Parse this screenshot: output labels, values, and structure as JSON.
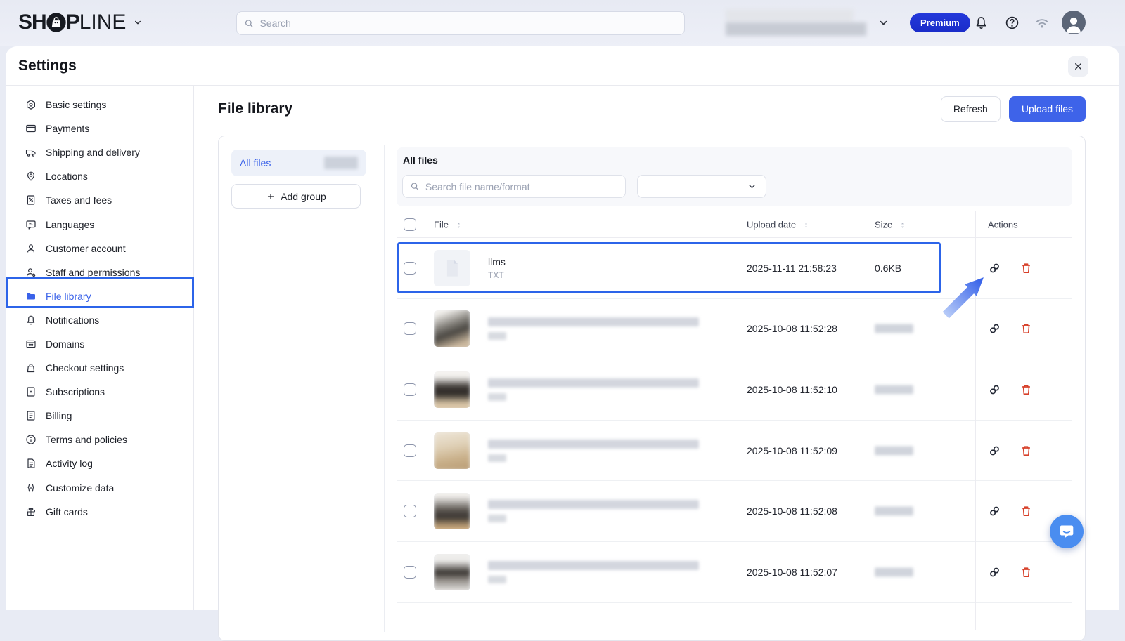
{
  "topbar": {
    "logo_part1": "SH",
    "logo_part2": "P",
    "logo_part3": "LINE",
    "logo_icon": "shopline-bag-icon",
    "search_placeholder": "Search",
    "premium_label": "Premium",
    "icons": [
      "bell-icon",
      "help-icon",
      "wifi-icon",
      "avatar"
    ]
  },
  "settings": {
    "title": "Settings",
    "close_icon": "close-icon"
  },
  "sidebar": {
    "items": [
      {
        "label": "Basic settings",
        "icon": "hexgear"
      },
      {
        "label": "Payments",
        "icon": "card"
      },
      {
        "label": "Shipping and delivery",
        "icon": "truck"
      },
      {
        "label": "Locations",
        "icon": "pin"
      },
      {
        "label": "Taxes and fees",
        "icon": "receipt"
      },
      {
        "label": "Languages",
        "icon": "chat"
      },
      {
        "label": "Customer account",
        "icon": "person"
      },
      {
        "label": "Staff and permissions",
        "icon": "people"
      },
      {
        "label": "File library",
        "icon": "folder",
        "active": true
      },
      {
        "label": "Notifications",
        "icon": "bell"
      },
      {
        "label": "Domains",
        "icon": "browser"
      },
      {
        "label": "Checkout settings",
        "icon": "bag"
      },
      {
        "label": "Subscriptions",
        "icon": "docplus"
      },
      {
        "label": "Billing",
        "icon": "doclines"
      },
      {
        "label": "Terms and policies",
        "icon": "info"
      },
      {
        "label": "Activity log",
        "icon": "doc"
      },
      {
        "label": "Customize data",
        "icon": "braces"
      },
      {
        "label": "Gift cards",
        "icon": "gift"
      }
    ]
  },
  "main": {
    "title": "File library",
    "refresh_label": "Refresh",
    "upload_label": "Upload files",
    "groups": {
      "all_files": "All files",
      "add_group": "Add group",
      "count_blurred": true
    },
    "files": {
      "heading": "All files",
      "search_placeholder": "Search file name/format",
      "columns": {
        "file": "File",
        "upload_date": "Upload date",
        "size": "Size",
        "actions": "Actions"
      },
      "rows": [
        {
          "name": "llms",
          "format": "TXT",
          "upload_date": "2025-11-11 21:58:23",
          "size": "0.6KB",
          "thumb": "doc",
          "highlighted": true,
          "blurred": false
        },
        {
          "upload_date": "2025-10-08 11:52:28",
          "thumb": "ph1",
          "blurred": true
        },
        {
          "upload_date": "2025-10-08 11:52:10",
          "thumb": "ph2",
          "blurred": true
        },
        {
          "upload_date": "2025-10-08 11:52:09",
          "thumb": "ph3",
          "blurred": true
        },
        {
          "upload_date": "2025-10-08 11:52:08",
          "thumb": "ph4",
          "blurred": true
        },
        {
          "upload_date": "2025-10-08 11:52:07",
          "thumb": "ph5",
          "blurred": true
        }
      ]
    }
  },
  "colors": {
    "accent": "#3a62e9",
    "annotation": "#2c64e9",
    "danger": "#d7402a",
    "premium_badge": "#1e32d6",
    "chat_launcher": "#4a8df0",
    "active_bg": "#edf1f9"
  }
}
